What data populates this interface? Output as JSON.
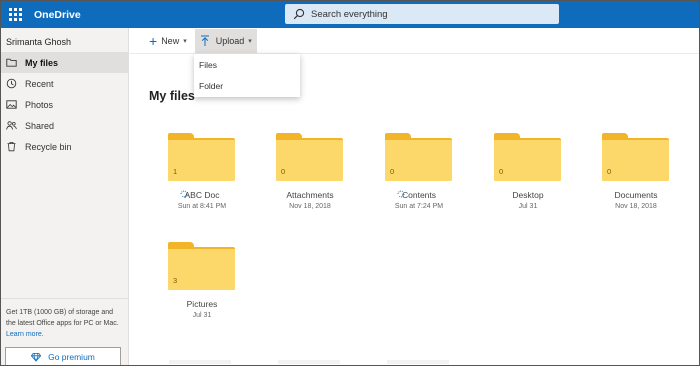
{
  "topbar": {
    "brand": "OneDrive",
    "search_placeholder": "Search everything",
    "accent": "#0f6cbd"
  },
  "sidebar": {
    "user_name": "Srimanta Ghosh",
    "items": [
      {
        "label": "My files",
        "icon": "folder-icon",
        "active": true
      },
      {
        "label": "Recent",
        "icon": "clock-icon"
      },
      {
        "label": "Photos",
        "icon": "photo-icon"
      },
      {
        "label": "Shared",
        "icon": "people-icon"
      },
      {
        "label": "Recycle bin",
        "icon": "trash-icon"
      }
    ],
    "storage_text": "Get 1TB (1000 GB) of storage and the latest Office apps for PC or Mac.",
    "learn_more": "Learn more.",
    "premium_label": "Go premium"
  },
  "commandbar": {
    "new_label": "New",
    "upload_label": "Upload"
  },
  "upload_menu": {
    "items": [
      "Files",
      "Folder"
    ]
  },
  "main": {
    "title": "My files",
    "folders": [
      {
        "name": "ABC Doc",
        "date": "Sun at 8:41 PM",
        "count": "1",
        "syncing": true
      },
      {
        "name": "Attachments",
        "date": "Nov 18, 2018",
        "count": "0",
        "syncing": false
      },
      {
        "name": "Contents",
        "date": "Sun at 7:24 PM",
        "count": "0",
        "syncing": true
      },
      {
        "name": "Desktop",
        "date": "Jul 31",
        "count": "0",
        "syncing": false
      },
      {
        "name": "Documents",
        "date": "Nov 18, 2018",
        "count": "0",
        "syncing": false
      },
      {
        "name": "Pictures",
        "date": "Jul 31",
        "count": "3",
        "syncing": false
      }
    ]
  }
}
